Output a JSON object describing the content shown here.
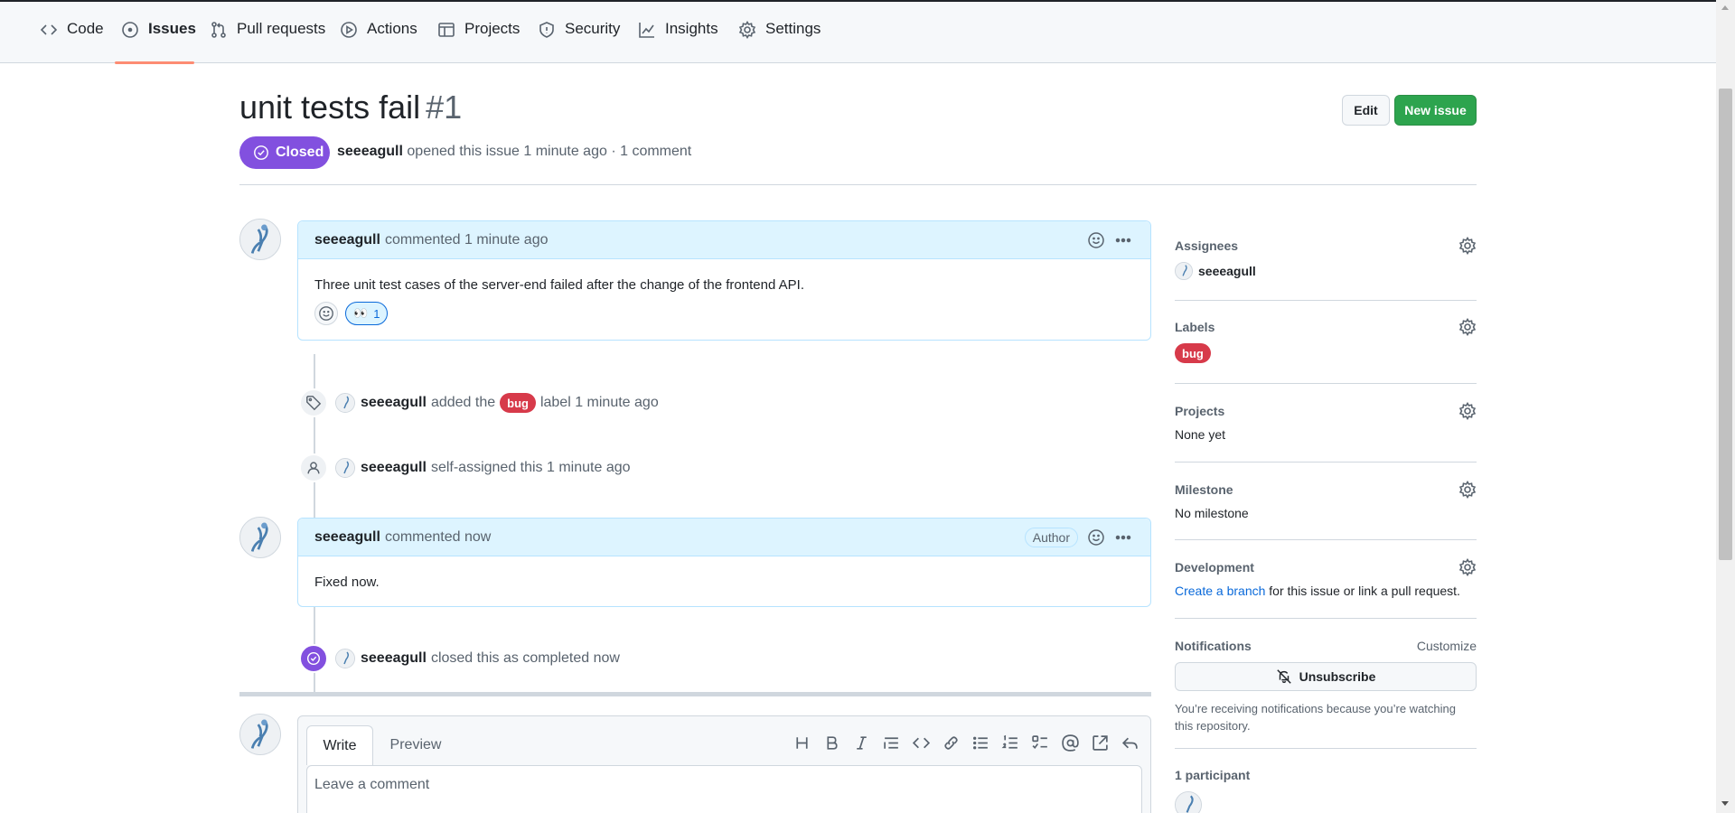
{
  "colors": {
    "accent_closed": "#8250df",
    "primary_button": "#2da44e",
    "label_bug": "#d73a4a",
    "link": "#0969da",
    "tab_underline": "#fd8c73"
  },
  "repo_nav": {
    "tabs": [
      {
        "label": "Code",
        "icon": "code-icon"
      },
      {
        "label": "Issues",
        "icon": "issue-opened-icon",
        "active": true
      },
      {
        "label": "Pull requests",
        "icon": "git-pull-request-icon"
      },
      {
        "label": "Actions",
        "icon": "play-icon"
      },
      {
        "label": "Projects",
        "icon": "table-icon"
      },
      {
        "label": "Security",
        "icon": "shield-icon"
      },
      {
        "label": "Insights",
        "icon": "graph-icon"
      },
      {
        "label": "Settings",
        "icon": "gear-icon"
      }
    ]
  },
  "issue": {
    "title": "unit tests fail",
    "number": "#1",
    "state": "Closed",
    "author": "seeeagull",
    "meta_rest": "opened this issue 1 minute ago · 1 comment",
    "edit_label": "Edit",
    "new_issue_label": "New issue"
  },
  "timeline": {
    "comment1": {
      "author": "seeeagull",
      "action": "commented 1 minute ago",
      "body": "Three unit test cases of the server-end failed after the change of the frontend API.",
      "reaction_count": "1",
      "reaction_icon": "eyes-emoji"
    },
    "event_label": {
      "author": "seeeagull",
      "text_before": "added the",
      "label": "bug",
      "text_after": "label 1 minute ago",
      "icon": "tag-icon"
    },
    "event_assign": {
      "author": "seeeagull",
      "text": "self-assigned this 1 minute ago",
      "icon": "person-icon"
    },
    "comment2": {
      "author": "seeeagull",
      "action": "commented now",
      "badge": "Author",
      "body": "Fixed now."
    },
    "event_closed": {
      "author": "seeeagull",
      "text": "closed this as completed now",
      "icon": "issue-closed-icon"
    }
  },
  "composer": {
    "tab_write": "Write",
    "tab_preview": "Preview",
    "placeholder": "Leave a comment"
  },
  "sidebar": {
    "assignees": {
      "heading": "Assignees",
      "value": "seeeagull"
    },
    "labels": {
      "heading": "Labels",
      "value": "bug"
    },
    "projects": {
      "heading": "Projects",
      "value": "None yet"
    },
    "milestone": {
      "heading": "Milestone",
      "value": "No milestone"
    },
    "development": {
      "heading": "Development",
      "link": "Create a branch",
      "rest": "for this issue or link a pull request."
    },
    "notifications": {
      "heading": "Notifications",
      "customize": "Customize",
      "button": "Unsubscribe",
      "note": "You’re receiving notifications because you’re watching this repository."
    },
    "participants": {
      "heading": "1 participant"
    }
  }
}
